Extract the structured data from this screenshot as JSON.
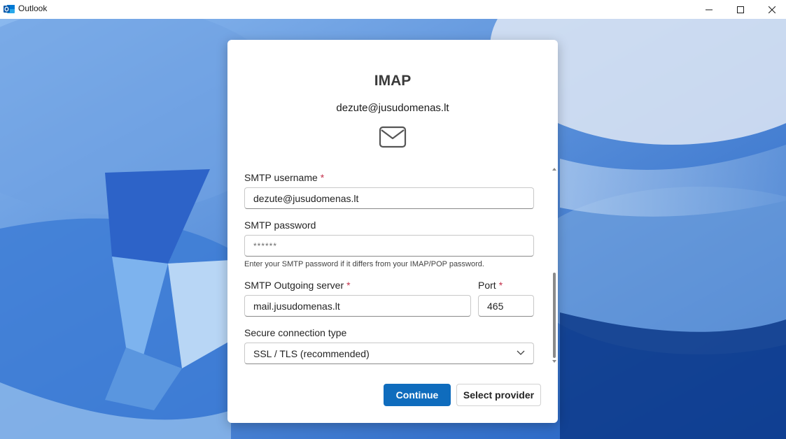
{
  "window": {
    "title": "Outlook"
  },
  "dialog": {
    "title": "IMAP",
    "email": "dezute@jusudomenas.lt"
  },
  "form": {
    "smtp_username": {
      "label": "SMTP username",
      "required_mark": "*",
      "value": "dezute@jusudomenas.lt"
    },
    "smtp_password": {
      "label": "SMTP password",
      "value": "******",
      "hint": "Enter your SMTP password if it differs from your IMAP/POP password."
    },
    "smtp_server": {
      "label": "SMTP Outgoing server",
      "required_mark": "*",
      "value": "mail.jusudomenas.lt"
    },
    "port": {
      "label": "Port",
      "required_mark": "*",
      "value": "465"
    },
    "secure_connection": {
      "label": "Secure connection type",
      "selected": "SSL / TLS (recommended)"
    }
  },
  "buttons": {
    "continue": "Continue",
    "select_provider": "Select provider"
  },
  "colors": {
    "primary": "#0f6cbd",
    "required": "#c4314b"
  }
}
